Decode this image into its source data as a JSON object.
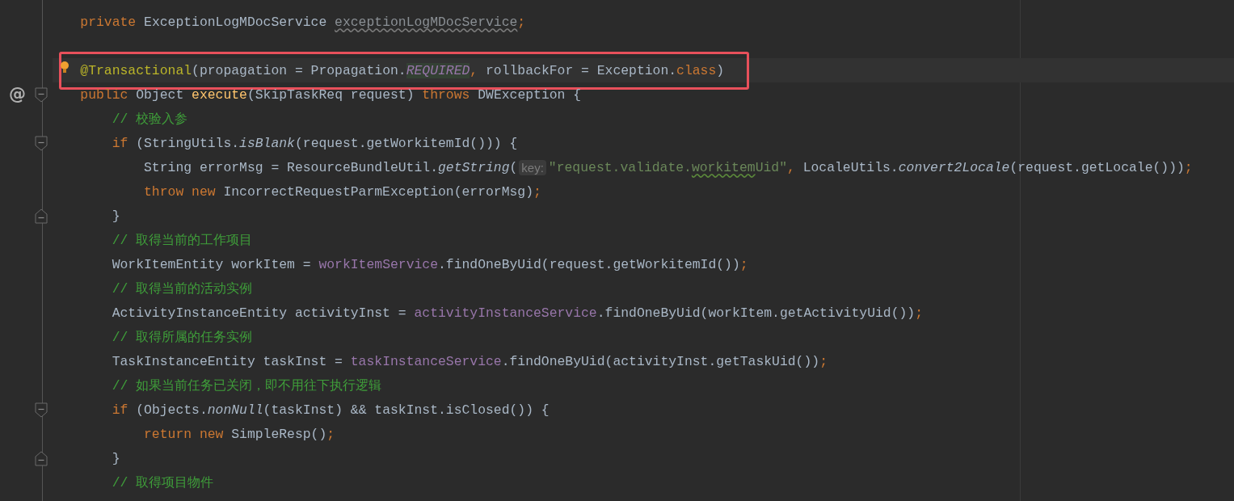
{
  "editor": {
    "lines": [
      {
        "kind": "code",
        "tokens": [
          {
            "text": "private",
            "kind": "keyword"
          },
          {
            "text": " ExceptionLogMDocService ",
            "kind": "plain"
          },
          {
            "text": "exceptionLogMDocService",
            "kind": "unused"
          },
          {
            "text": ";",
            "kind": "punct"
          }
        ]
      },
      {
        "kind": "blank"
      },
      {
        "kind": "code",
        "current": true,
        "boxed": true,
        "intention": true,
        "tokens": [
          {
            "text": "@Transactional",
            "kind": "annotation"
          },
          {
            "text": "(propagation = Propagation.",
            "kind": "plain"
          },
          {
            "text": "REQUIRED",
            "kind": "constant_match"
          },
          {
            "text": ",",
            "kind": "punct"
          },
          {
            "text": " rollbackFor = Exception.",
            "kind": "plain"
          },
          {
            "text": "class",
            "kind": "keyword"
          },
          {
            "text": ")",
            "kind": "plain"
          }
        ]
      },
      {
        "kind": "code",
        "gutter_text": "@",
        "fold_start": true,
        "tokens": [
          {
            "text": "public",
            "kind": "keyword"
          },
          {
            "text": " Object ",
            "kind": "plain"
          },
          {
            "text": "execute",
            "kind": "method"
          },
          {
            "text": "(SkipTaskReq request) ",
            "kind": "plain"
          },
          {
            "text": "throws",
            "kind": "keyword"
          },
          {
            "text": " DWException {",
            "kind": "plain"
          }
        ],
        "children": [
          {
            "kind": "code",
            "tokens": [
              {
                "text": "// 校验入参",
                "kind": "comment"
              }
            ]
          },
          {
            "kind": "code",
            "fold_start": true,
            "tokens": [
              {
                "text": "if",
                "kind": "keyword"
              },
              {
                "text": " (StringUtils.",
                "kind": "plain"
              },
              {
                "text": "isBlank",
                "kind": "static"
              },
              {
                "text": "(request.getWorkitemId())) {",
                "kind": "plain"
              }
            ],
            "children": [
              {
                "kind": "code",
                "tokens": [
                  {
                    "text": "String errorMsg = ResourceBundleUtil.",
                    "kind": "plain"
                  },
                  {
                    "text": "getString",
                    "kind": "static"
                  },
                  {
                    "text": "(",
                    "kind": "plain"
                  },
                  {
                    "text": "key:",
                    "kind": "hint"
                  },
                  {
                    "text": "\"request.validate.",
                    "kind": "string"
                  },
                  {
                    "text": "workitem",
                    "kind": "typo"
                  },
                  {
                    "text": "Uid\"",
                    "kind": "string"
                  },
                  {
                    "text": ",",
                    "kind": "punct"
                  },
                  {
                    "text": " LocaleUtils.",
                    "kind": "plain"
                  },
                  {
                    "text": "convert2Locale",
                    "kind": "static"
                  },
                  {
                    "text": "(request.getLocale()))",
                    "kind": "plain"
                  },
                  {
                    "text": ";",
                    "kind": "punct"
                  }
                ]
              },
              {
                "kind": "code",
                "tokens": [
                  {
                    "text": "throw new",
                    "kind": "keyword"
                  },
                  {
                    "text": " IncorrectRequestParmException(errorMsg)",
                    "kind": "plain"
                  },
                  {
                    "text": ";",
                    "kind": "punct"
                  }
                ]
              }
            ]
          },
          {
            "kind": "code",
            "fold_end": true,
            "tokens": [
              {
                "text": "}",
                "kind": "plain"
              }
            ]
          },
          {
            "kind": "code",
            "tokens": [
              {
                "text": "// 取得当前的工作项目",
                "kind": "comment"
              }
            ]
          },
          {
            "kind": "code",
            "tokens": [
              {
                "text": "WorkItemEntity workItem = ",
                "kind": "plain"
              },
              {
                "text": "workItemService",
                "kind": "field"
              },
              {
                "text": ".findOneByUid(request.getWorkitemId())",
                "kind": "plain"
              },
              {
                "text": ";",
                "kind": "punct"
              }
            ]
          },
          {
            "kind": "code",
            "tokens": [
              {
                "text": "// 取得当前的活动实例",
                "kind": "comment"
              }
            ]
          },
          {
            "kind": "code",
            "tokens": [
              {
                "text": "ActivityInstanceEntity activityInst = ",
                "kind": "plain"
              },
              {
                "text": "activityInstanceService",
                "kind": "field"
              },
              {
                "text": ".findOneByUid(workItem.getActivityUid())",
                "kind": "plain"
              },
              {
                "text": ";",
                "kind": "punct"
              }
            ]
          },
          {
            "kind": "code",
            "tokens": [
              {
                "text": "// 取得所属的任务实例",
                "kind": "comment"
              }
            ]
          },
          {
            "kind": "code",
            "tokens": [
              {
                "text": "TaskInstanceEntity taskInst = ",
                "kind": "plain"
              },
              {
                "text": "taskInstanceService",
                "kind": "field"
              },
              {
                "text": ".findOneByUid(activityInst.getTaskUid())",
                "kind": "plain"
              },
              {
                "text": ";",
                "kind": "punct"
              }
            ]
          },
          {
            "kind": "code",
            "tokens": [
              {
                "text": "// 如果当前任务已关闭，即不用往下执行逻辑",
                "kind": "comment"
              }
            ]
          },
          {
            "kind": "code",
            "fold_start": true,
            "tokens": [
              {
                "text": "if",
                "kind": "keyword"
              },
              {
                "text": " (Objects.",
                "kind": "plain"
              },
              {
                "text": "nonNull",
                "kind": "static"
              },
              {
                "text": "(taskInst) && taskInst.isClosed()) {",
                "kind": "plain"
              }
            ],
            "children": [
              {
                "kind": "code",
                "tokens": [
                  {
                    "text": "return new",
                    "kind": "keyword"
                  },
                  {
                    "text": " SimpleResp()",
                    "kind": "plain"
                  },
                  {
                    "text": ";",
                    "kind": "punct"
                  }
                ]
              }
            ]
          },
          {
            "kind": "code",
            "fold_end": true,
            "tokens": [
              {
                "text": "}",
                "kind": "plain"
              }
            ]
          },
          {
            "kind": "code",
            "tokens": [
              {
                "text": "// 取得项目物件",
                "kind": "comment"
              }
            ]
          }
        ]
      }
    ]
  }
}
